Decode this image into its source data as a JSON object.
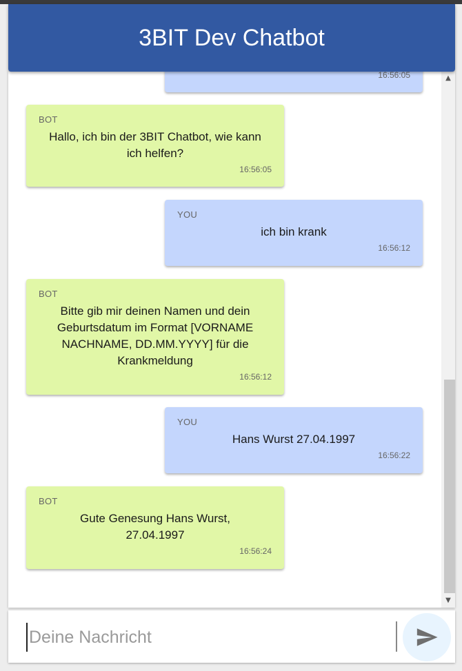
{
  "header": {
    "title": "3BIT Dev Chatbot"
  },
  "messages": [
    {
      "sender": "",
      "text": "",
      "time": "16:56:05",
      "role": "you"
    },
    {
      "sender": "BOT",
      "text": "Hallo, ich bin der 3BIT Chatbot, wie kann ich helfen?",
      "time": "16:56:05",
      "role": "bot"
    },
    {
      "sender": "YOU",
      "text": "ich bin krank",
      "time": "16:56:12",
      "role": "you"
    },
    {
      "sender": "BOT",
      "text": "Bitte gib mir deinen Namen und dein Geburtsdatum im Format [VORNAME NACHNAME, DD.MM.YYYY] für die Krankmeldung",
      "time": "16:56:12",
      "role": "bot"
    },
    {
      "sender": "YOU",
      "text": "Hans Wurst 27.04.1997",
      "time": "16:56:22",
      "role": "you"
    },
    {
      "sender": "BOT",
      "text": "Gute Genesung Hans Wurst, 27.04.1997",
      "time": "16:56:24",
      "role": "bot"
    }
  ],
  "input": {
    "placeholder": "Deine Nachricht",
    "value": ""
  },
  "icons": {
    "send": "send-icon",
    "scroll_up": "scroll-up-arrow-icon",
    "scroll_down": "scroll-down-arrow-icon"
  },
  "colors": {
    "header": "#3259a2",
    "bot_bubble": "#e1f7a7",
    "user_bubble": "#c4d6fd",
    "send_button_bg": "#e8f4fe"
  }
}
